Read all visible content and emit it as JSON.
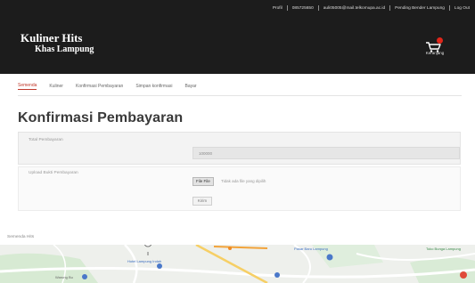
{
  "header": {
    "top_links": [
      "Profil",
      "085725650",
      "auli05005@mail.telkomupa.ac.id",
      "Pending Bender Lampung",
      "Log Out"
    ],
    "brand_line1": "Kuliner Hits",
    "brand_line2": "Khas Lampung",
    "cart_label": "Keranjang"
  },
  "tabs": [
    {
      "label": "Semenda",
      "active": true
    },
    {
      "label": "Kuliner",
      "active": false
    },
    {
      "label": "Konfirmasi Pembayaran",
      "active": false
    },
    {
      "label": "Simpan konfirmasi",
      "active": false
    },
    {
      "label": "Bayar",
      "active": false
    }
  ],
  "form": {
    "title": "Konfirmasi Pembayaran",
    "total_label": "Total Pembayaran",
    "total_value": "100000",
    "upload_label": "Upload Bukti Pembayaran",
    "file_button": "File File",
    "file_status": "Tidak ada file yang dipilih",
    "submit_label": "Kirim"
  },
  "map": {
    "label": "Semenda Hits",
    "place_labels": [
      "Pasar Baru Lampung",
      "Toko Bunga Lampung",
      "Hotel Lampung Indah",
      "Warung Bu"
    ]
  },
  "colors": {
    "header_bg": "#1c1c1c",
    "accent_red": "#c0392b",
    "badge_red": "#e0261a"
  }
}
